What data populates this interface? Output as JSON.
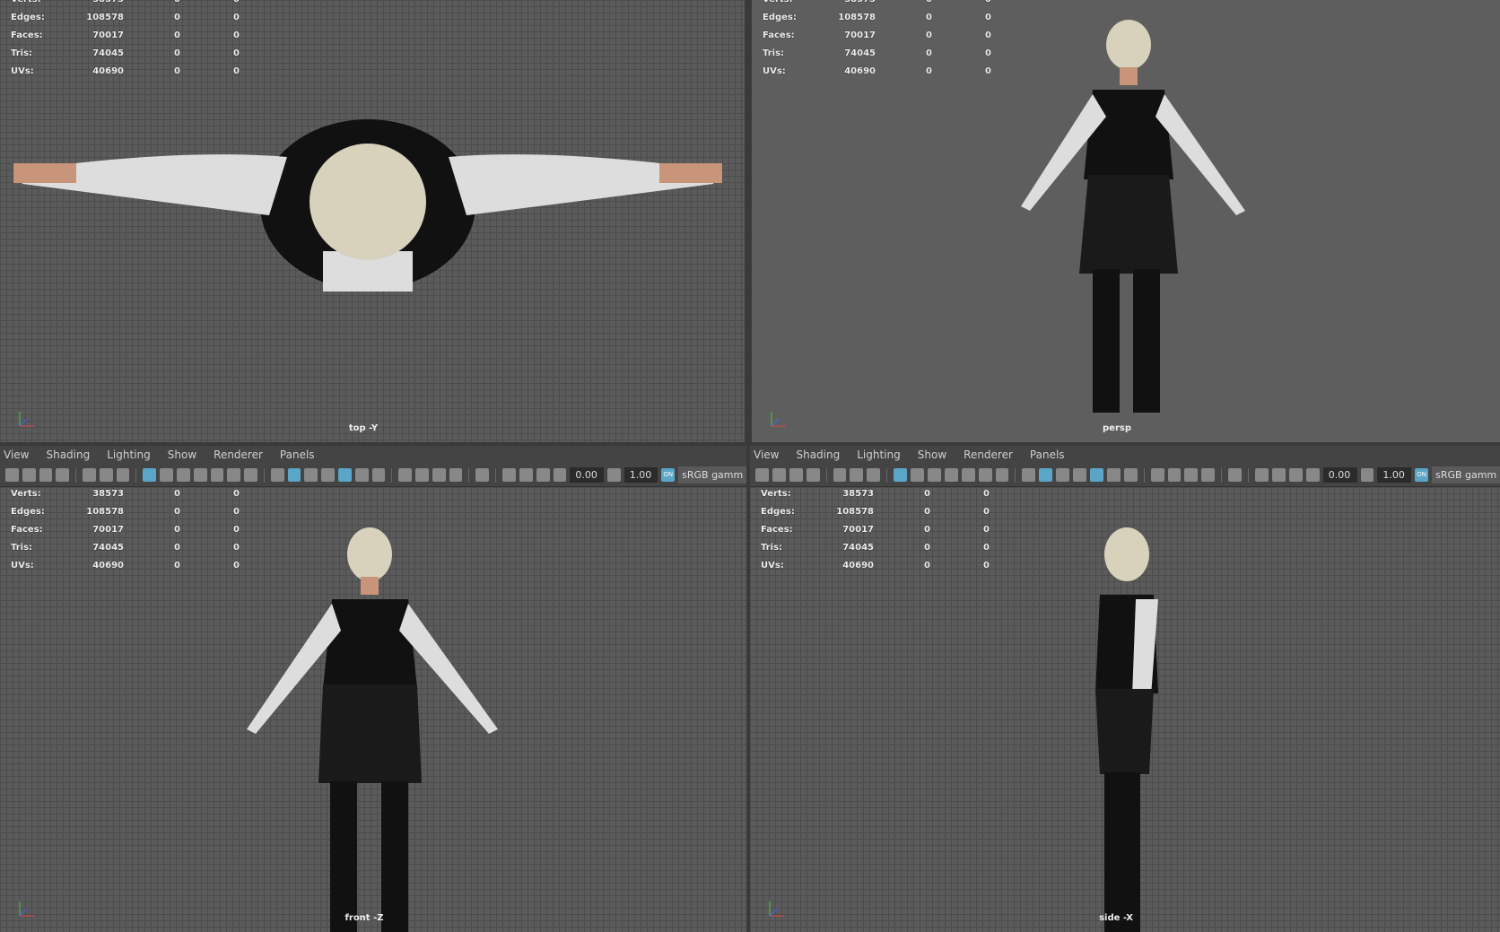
{
  "menu": [
    "View",
    "Shading",
    "Lighting",
    "Show",
    "Renderer",
    "Panels"
  ],
  "toolbar": {
    "exposure": "0.00",
    "gamma": "1.00",
    "color_space": "sRGB gamm",
    "toggle_on": "ON"
  },
  "hud": {
    "rows": [
      {
        "label": "Verts:",
        "value": "38573",
        "a": "0",
        "b": "0"
      },
      {
        "label": "Edges:",
        "value": "108578",
        "a": "0",
        "b": "0"
      },
      {
        "label": "Faces:",
        "value": "70017",
        "a": "0",
        "b": "0"
      },
      {
        "label": "Tris:",
        "value": "74045",
        "a": "0",
        "b": "0"
      },
      {
        "label": "UVs:",
        "value": "40690",
        "a": "0",
        "b": "0"
      }
    ]
  },
  "viewports": [
    {
      "camera": "top -Y",
      "menu": false,
      "grid": true
    },
    {
      "camera": "persp",
      "menu": false,
      "grid": false
    },
    {
      "camera": "front -Z",
      "menu": true,
      "grid": true
    },
    {
      "camera": "side -X",
      "menu": true,
      "grid": true
    }
  ],
  "colors": {
    "accent": "#5aa5c8",
    "viewport": "#5b5b5b",
    "panel": "#444444"
  }
}
